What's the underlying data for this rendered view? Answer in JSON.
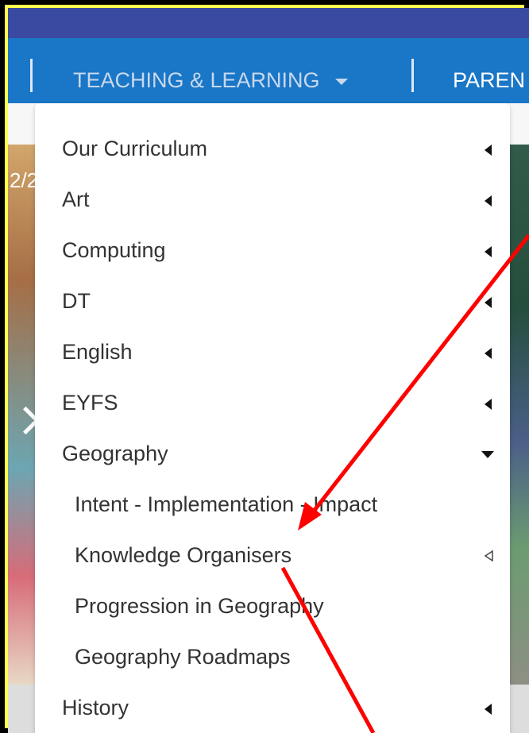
{
  "navbar": {
    "item_teaching": "TEACHING & LEARNING",
    "item_parents": "PAREN"
  },
  "hero": {
    "counter_text": "2/2"
  },
  "menu": {
    "items": [
      {
        "label": "Our Curriculum",
        "indicator": "left-caret"
      },
      {
        "label": "Art",
        "indicator": "left-caret"
      },
      {
        "label": "Computing",
        "indicator": "left-caret"
      },
      {
        "label": "DT",
        "indicator": "left-caret"
      },
      {
        "label": "English",
        "indicator": "left-caret"
      },
      {
        "label": "EYFS",
        "indicator": "left-caret"
      },
      {
        "label": "Geography",
        "indicator": "down-caret"
      },
      {
        "label": "Intent - Implementation - Impact",
        "indicator": "none"
      },
      {
        "label": "Knowledge Organisers",
        "indicator": "left-caret-outline"
      },
      {
        "label": "Progression in Geography",
        "indicator": "none"
      },
      {
        "label": "Geography Roadmaps",
        "indicator": "none"
      },
      {
        "label": "History",
        "indicator": "left-caret"
      }
    ]
  },
  "annotation": {
    "color": "#ff0000"
  },
  "colors": {
    "frame": "#ffff4d",
    "navbar": "#1a76c6",
    "topbar": "#3a4aa0"
  }
}
